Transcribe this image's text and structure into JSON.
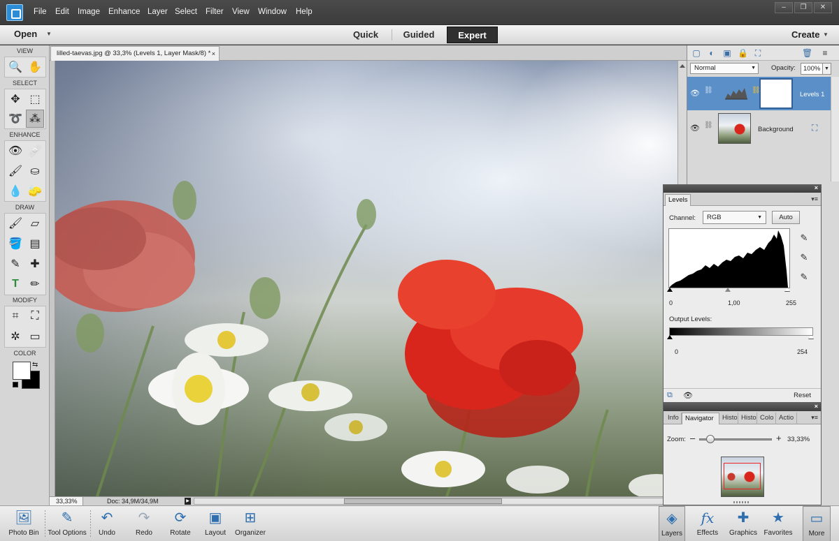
{
  "menu": [
    "File",
    "Edit",
    "Image",
    "Enhance",
    "Layer",
    "Select",
    "Filter",
    "View",
    "Window",
    "Help"
  ],
  "window_controls": [
    "–",
    "❐",
    "✕"
  ],
  "modebar": {
    "open_label": "Open",
    "modes": [
      "Quick",
      "Guided",
      "Expert"
    ],
    "active_mode": "Expert",
    "create_label": "Create"
  },
  "toolbox": {
    "sections": {
      "view": "VIEW",
      "select": "SELECT",
      "enhance": "ENHANCE",
      "draw": "DRAW",
      "modify": "MODIFY",
      "color": "COLOR"
    },
    "icons": {
      "zoom": "zoom-icon",
      "hand": "hand-icon",
      "move": "move-icon",
      "marquee": "rectangular-marquee-icon",
      "lasso": "lasso-icon",
      "quick_selection": "quick-selection-icon",
      "red_eye": "red-eye-icon",
      "healing": "spot-healing-icon",
      "smart_brush": "smart-brush-icon",
      "clone": "clone-stamp-icon",
      "blur": "blur-icon",
      "sponge": "sponge-icon",
      "brush": "brush-icon",
      "eraser": "eraser-icon",
      "paint_bucket": "paint-bucket-icon",
      "gradient": "gradient-icon",
      "eyedropper": "eyedropper-icon",
      "custom_shape": "custom-shape-icon",
      "type": "type-icon",
      "pencil": "pencil-icon",
      "crop": "crop-icon",
      "recompose": "recompose-icon",
      "content_aware_move": "content-aware-move-icon",
      "straighten": "straighten-icon"
    }
  },
  "document": {
    "tab_title": "lilled-taevas.jpg @ 33,3% (Levels 1, Layer Mask/8) *",
    "close_label": "×",
    "zoom_status": "33,33%",
    "doc_status": "Doc: 34,9M/34,9M"
  },
  "layers_panel": {
    "blend_mode": "Normal",
    "opacity_label": "Opacity:",
    "opacity_value": "100%",
    "layers": [
      {
        "name": "Levels 1",
        "selected": true
      },
      {
        "name": "Background",
        "selected": false
      }
    ]
  },
  "levels_panel": {
    "tab": "Levels",
    "channel_label": "Channel:",
    "channel_value": "RGB",
    "auto_label": "Auto",
    "input_levels": [
      "0",
      "1,00",
      "255"
    ],
    "output_label": "Output Levels:",
    "output_levels": [
      "0",
      "254"
    ],
    "reset_label": "Reset"
  },
  "navigator_panel": {
    "tabs": [
      "Info",
      "Navigator",
      "Histo",
      "Histo",
      "Colo",
      "Actio"
    ],
    "active_tab": "Navigator",
    "zoom_label": "Zoom:",
    "zoom_value": "33,33%",
    "zoom_fraction": 0.1
  },
  "bottombar": {
    "left_buttons": [
      "Photo Bin",
      "Tool Options",
      "Undo",
      "Redo",
      "Rotate",
      "Layout",
      "Organizer"
    ],
    "right_buttons": [
      "Layers",
      "Effects",
      "Graphics",
      "Favorites",
      "More"
    ]
  }
}
